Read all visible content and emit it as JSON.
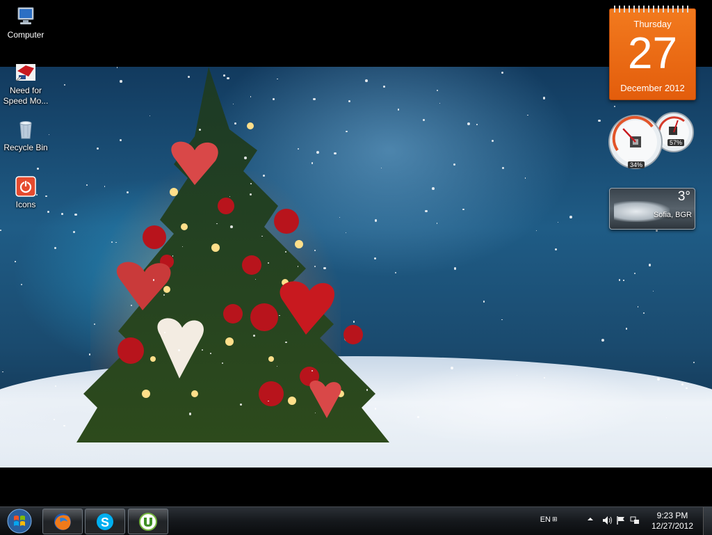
{
  "desktop": {
    "icons": [
      {
        "label": "Computer",
        "icon": "computer-icon"
      },
      {
        "label": "Need for\nSpeed Mo...",
        "icon": "nfs-game-icon"
      },
      {
        "label": "Recycle Bin",
        "icon": "recycle-bin-icon"
      },
      {
        "label": "Icons",
        "icon": "power-icon"
      }
    ]
  },
  "gadgets": {
    "calendar": {
      "weekday": "Thursday",
      "day": "27",
      "month_year": "December 2012",
      "color": "#ef6f17"
    },
    "cpu_meter": {
      "cpu_percent": "34%",
      "memory_percent": "57%",
      "cpu_level": 0.34,
      "memory_level": 0.57
    },
    "weather": {
      "temperature": "3°",
      "location": "Sofia, BGR"
    }
  },
  "taskbar": {
    "pinned": [
      {
        "name": "firefox",
        "icon": "firefox-icon"
      },
      {
        "name": "skype",
        "icon": "skype-icon"
      },
      {
        "name": "utorrent",
        "icon": "utorrent-icon"
      }
    ],
    "language": "EN",
    "clock": {
      "time": "9:23 PM",
      "date": "12/27/2012"
    }
  },
  "colors": {
    "taskbar": "#15181c",
    "accent_orange": "#ef6f17",
    "wallpaper_blue": "#1f5c86"
  }
}
